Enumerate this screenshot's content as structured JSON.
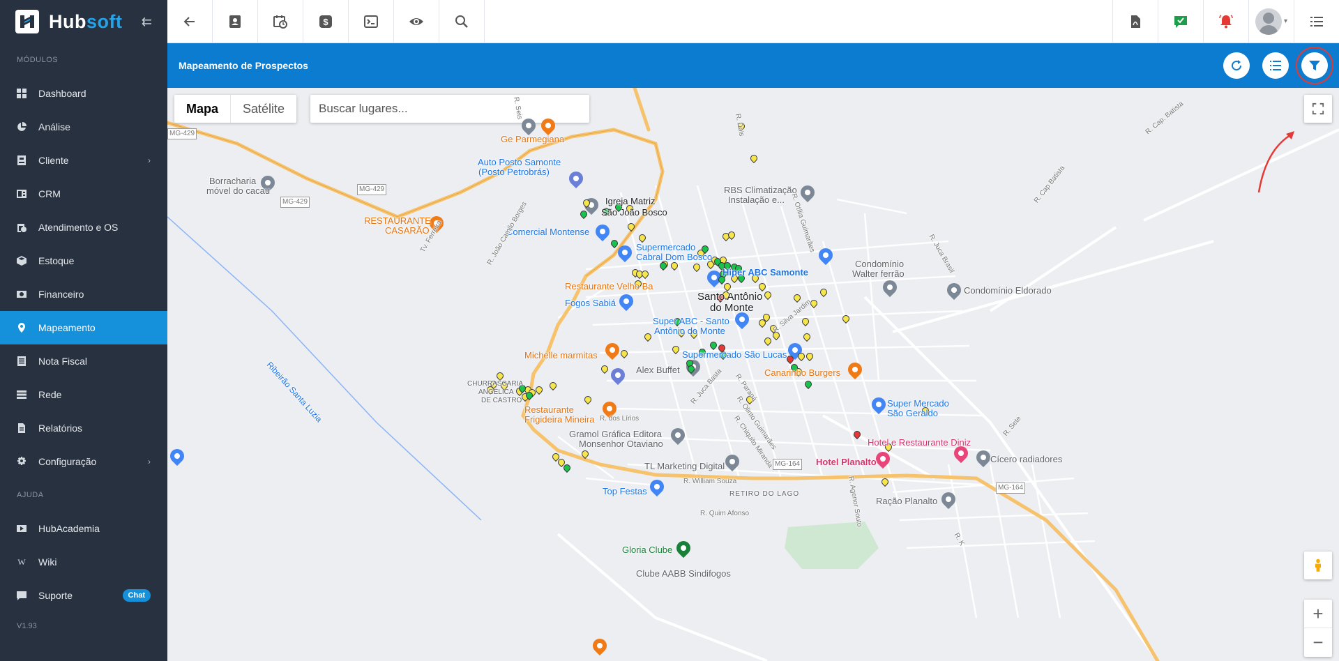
{
  "brand": {
    "name_a": "Hub",
    "name_b": "soft"
  },
  "sidebar": {
    "section_modules": "MÓDULOS",
    "section_help": "AJUDA",
    "version": "V1.93",
    "items": [
      {
        "label": "Dashboard",
        "icon": "dashboard-icon"
      },
      {
        "label": "Análise",
        "icon": "pie-chart-icon"
      },
      {
        "label": "Cliente",
        "icon": "id-card-icon",
        "chevron": "›"
      },
      {
        "label": "CRM",
        "icon": "crm-icon"
      },
      {
        "label": "Atendimento e OS",
        "icon": "calendar-clock-icon"
      },
      {
        "label": "Estoque",
        "icon": "box-icon"
      },
      {
        "label": "Financeiro",
        "icon": "money-icon"
      },
      {
        "label": "Mapeamento",
        "icon": "map-pin-icon",
        "active": true
      },
      {
        "label": "Nota Fiscal",
        "icon": "invoice-icon"
      },
      {
        "label": "Rede",
        "icon": "server-icon"
      },
      {
        "label": "Relatórios",
        "icon": "report-icon"
      },
      {
        "label": "Configuração",
        "icon": "gear-icon",
        "chevron": "›"
      }
    ],
    "help_items": [
      {
        "label": "HubAcademia",
        "icon": "play-icon"
      },
      {
        "label": "Wiki",
        "icon": "wiki-icon"
      },
      {
        "label": "Suporte",
        "icon": "chat-icon",
        "badge": "Chat"
      }
    ]
  },
  "page": {
    "title": "Mapeamento de Prospectos"
  },
  "map": {
    "type_map": "Mapa",
    "type_satellite": "Satélite",
    "search_placeholder": "Buscar lugares...",
    "labels": {
      "ge_parmegiana": "Ge Parmegiana",
      "auto_posto_1": "Auto Posto Samonte",
      "auto_posto_2": "(Posto Petrobrás)",
      "igreja_1": "Igreja Matriz",
      "igreja_2": "São João Bosco",
      "borracharia_1": "Borracharia",
      "borracharia_2": "móvel do cacau",
      "restaurante_casarao_1": "RESTAURANTE",
      "restaurante_casarao_2": "CASARÃO",
      "comercial_montense": "Comercial Montense",
      "supermercado_cabral_1": "Supermercado",
      "supermercado_cabral_2": "Cabral Dom Bosco",
      "rbs_1": "RBS Climatização",
      "rbs_2": "Instalação e...",
      "condominio_walter_1": "Condomínio",
      "condominio_walter_2": "Walter ferrão",
      "condominio_eldorado": "Condomínio Eldorado",
      "hiper_abc": "Hiper ABC Samonte",
      "restaurante_velho": "Restaurante Velho Ba",
      "fogos_sabia": "Fogos Sabiá",
      "santo_antonio_1": "Santo Antônio",
      "santo_antonio_2": "do Monte",
      "super_abc_1": "Super ABC - Santo",
      "super_abc_2": "Antônio do Monte",
      "michelle": "Michelle marmitas",
      "alex_buffet": "Alex Buffet",
      "supermercado_sao_lucas": "Supermercado São Lucas",
      "canarinho": "Canarinho Burgers",
      "super_mercado_sao_geraldo_1": "Super Mercado",
      "super_mercado_sao_geraldo_2": "São Geraldo",
      "restaurante_frigideira_1": "Restaurante",
      "restaurante_frigideira_2": "Frigideira Mineira",
      "churrascaria_1": "CHURRASCARIA",
      "churrascaria_2": "ANGÉLICA",
      "churrascaria_3": "DE CASTRO",
      "gramol_1": "Gramol Gráfica Editora",
      "gramol_2": "Monsenhor Otaviano",
      "hotel_diniz": "Hotel e Restaurante Diniz",
      "hotel_planalto": "Hotel Planalto",
      "cicero": "Cícero radiadores",
      "tl_marketing": "TL Marketing Digital",
      "top_festas": "Top Festas",
      "retiro_do_lago": "RETIRO DO LAGO",
      "racao_planalto": "Ração Planalto",
      "gloria_clube": "Gloria Clube",
      "clube_aabb": "Clube AABB Sindifogos",
      "ribeirao": "Ribeirão Santa Luzia",
      "r_seis": "R. Seis",
      "mg429_a": "MG-429",
      "mg429_b": "MG-429",
      "mg429_c": "MG-429",
      "mg164_a": "MG-164",
      "mg164_b": "MG-164",
      "r_cap_batista": "R. Cap. Batista",
      "r_cap_batista_2": "R. Cap Batista",
      "r_juca_brasil": "R. Juca Brasil",
      "r_otilia": "R. Otília Guimarães",
      "r_joao_camilo": "R. João Camilo Borges",
      "tv_ferreira": "Tv. Ferreira",
      "r_dos_lirios": "R. dos Lírios",
      "r_juca_basta": "R. Juca Basta",
      "r_parana": "R. Paraná",
      "r_olinto": "R. Olinto Guimarães",
      "r_chiquito": "R. Chiquito Miranda",
      "r_william": "R. William Souza",
      "r_quim": "R. Quim Afonso",
      "r_agenor": "R. Agenor Souto",
      "r_silva_jardim": "R. Silva Jardim",
      "r_dois": "R. Dois",
      "r_k": "R. K",
      "r_sete": "R. Sete"
    }
  }
}
